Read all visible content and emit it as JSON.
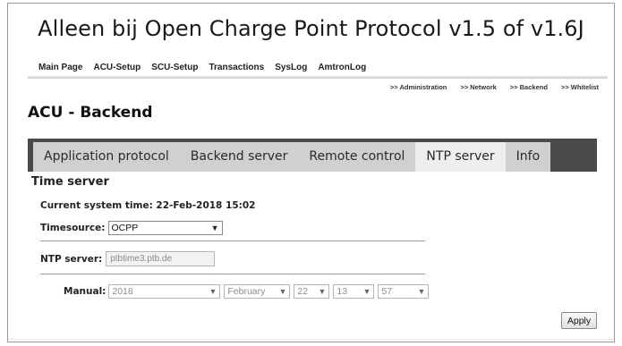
{
  "caption": "Alleen bij Open Charge Point Protocol v1.5 of v1.6J",
  "topnav": [
    "Main Page",
    "ACU-Setup",
    "SCU-Setup",
    "Transactions",
    "SysLog",
    "AmtronLog"
  ],
  "subnav": [
    ">> Administration",
    ">> Network",
    ">> Backend",
    ">> Whitelist"
  ],
  "page_title": "ACU - Backend",
  "tabs": [
    {
      "label": "Application protocol",
      "active": false
    },
    {
      "label": "Backend server",
      "active": false
    },
    {
      "label": "Remote control",
      "active": false
    },
    {
      "label": "NTP server",
      "active": true
    },
    {
      "label": "Info",
      "active": false
    }
  ],
  "panel": {
    "title": "Time server",
    "current_time_label": "Current system time: 22-Feb-2018 15:02",
    "timesource_label": "Timesource:",
    "timesource_value": "OCPP",
    "ntp_label": "NTP server:",
    "ntp_value": "ptbtime3.ptb.de",
    "manual_label": "Manual:",
    "manual_year": "2018",
    "manual_month": "February",
    "manual_day": "22",
    "manual_hour": "13",
    "manual_minute": "57",
    "apply_label": "Apply"
  },
  "icons": {
    "dropdown": "chevron-down-icon"
  }
}
